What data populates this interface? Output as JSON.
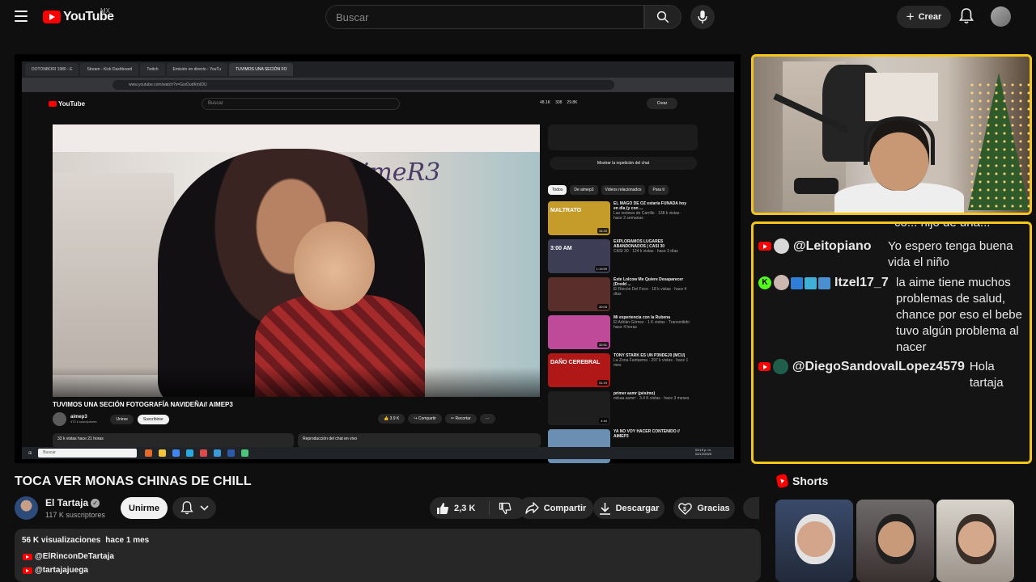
{
  "header": {
    "logo_text": "YouTube",
    "country": "MX",
    "search_placeholder": "Buscar",
    "create_label": "Crear"
  },
  "player": {
    "browser_tabs": [
      "DOTONBORI 1980 - E",
      "Stream - Kick Dashboard",
      "Twitch",
      "Emisión en directo - YouTu",
      "TUVIMOS UNA SECIÓN FO"
    ],
    "address": "www.youtube.com/watch?v=GsrDudKmIDU",
    "inner_yt": {
      "logo": "YouTube",
      "search_placeholder": "Buscar",
      "stats": [
        "48.1K",
        "308",
        "29.8K"
      ],
      "create_label": "Crear",
      "video_logo_text": "AimeR3",
      "video_title": "TUVIMOS UNA SECIÓN FOTOGRAFÍA NAVIDEÑA// AIMEP3",
      "channel_name": "aimep3",
      "channel_subs": "472 k suscriptores",
      "join_label": "Unirse",
      "subscribe_label": "Suscribirse",
      "like_count": "3.9 K",
      "share_label": "Compartir",
      "clip_label": "Recortar",
      "desc_left": "33 k vistas  hace 21 horas",
      "desc_right": "Reproducción del chat en vivo",
      "replay_label": "Mostrar la repetición del chat",
      "chips": [
        "Todos",
        "De aimep3",
        "Videos relacionados",
        "Para ti"
      ],
      "recs": [
        {
          "title": "EL MAGO DE OZ estaría FUNADA hoy en día (y con ...",
          "meta": "Las reviews de Carrillo · 138 k vistas · hace 2 semanas",
          "duration": "34:33",
          "thumb_text": "MALTRATO",
          "color": "#c59c2a"
        },
        {
          "title": "EXPLORAMOS LUGARES ABANDONADOS | CASI 30",
          "meta": "CASI 30 · 124 k vistas · hace 3 días",
          "duration": "1:19:59",
          "thumb_text": "3:00 AM",
          "color": "#3d3d55"
        },
        {
          "title": "Este Lolcow Me Quiere Desaparecer (Dredd ...",
          "meta": "El Rincón Del Foco · 18 k vistas · hace 4 días",
          "duration": "30:05",
          "thumb_text": "",
          "color": "#5a2e2a"
        },
        {
          "title": "Mi experiencia con la Rubena",
          "meta": "El Adrián Gómez · 1 K vistas · Transmitido hace 4 horas",
          "duration": "32:51",
          "thumb_text": "",
          "color": "#c04a9a"
        },
        {
          "title": "TONY STARK ES UN P3NDEJ0 (MCU)",
          "meta": "La Zona Fantasma · 297 k vistas · hace 1 mes",
          "duration": "31:19",
          "thumb_text": "DAÑO CEREBRAL",
          "color": "#b01818"
        },
        {
          "title": "primer asmr (pésimo)",
          "meta": "mikaa.asmrr · 3.4 K vistas · hace 3 meses",
          "duration": "4:44",
          "thumb_text": "",
          "color": "#1e1e1e"
        },
        {
          "title": "YA NO VOY HACER CONTENIDO // AIMEP3",
          "meta": "",
          "duration": "",
          "thumb_text": "",
          "color": "#6a8fb2"
        }
      ],
      "taskbar_search": "Buscar",
      "clock_time": "03:19 p. m.",
      "clock_date": "02/12/2025"
    }
  },
  "chat": {
    "cut_line": "co... hijo de una...",
    "messages": [
      {
        "platform": "youtube",
        "user": "@Leitopiano",
        "text": "Yo espero tenga buena vida el niño"
      },
      {
        "platform": "kick",
        "user": "Itzel17_7",
        "text": "la aime tiene muchos problemas de salud, chance por eso el bebe tuvo algún problema al nacer"
      },
      {
        "platform": "youtube",
        "user": "@DiegoSandovalLopez4579",
        "text": "Hola tartaja"
      }
    ]
  },
  "video": {
    "title": "TOCA VER MONAS CHINAS DE CHILL",
    "channel": "El Tartaja",
    "subscribers": "117 K suscriptores",
    "join_label": "Unirme",
    "likes": "2,3 K",
    "share_label": "Compartir",
    "download_label": "Descargar",
    "thanks_label": "Gracias",
    "views": "56 K visualizaciones",
    "time_ago": "hace 1 mes",
    "links": [
      "@ElRinconDeTartaja",
      "@tartajajuega"
    ]
  },
  "shorts": {
    "label": "Shorts"
  }
}
